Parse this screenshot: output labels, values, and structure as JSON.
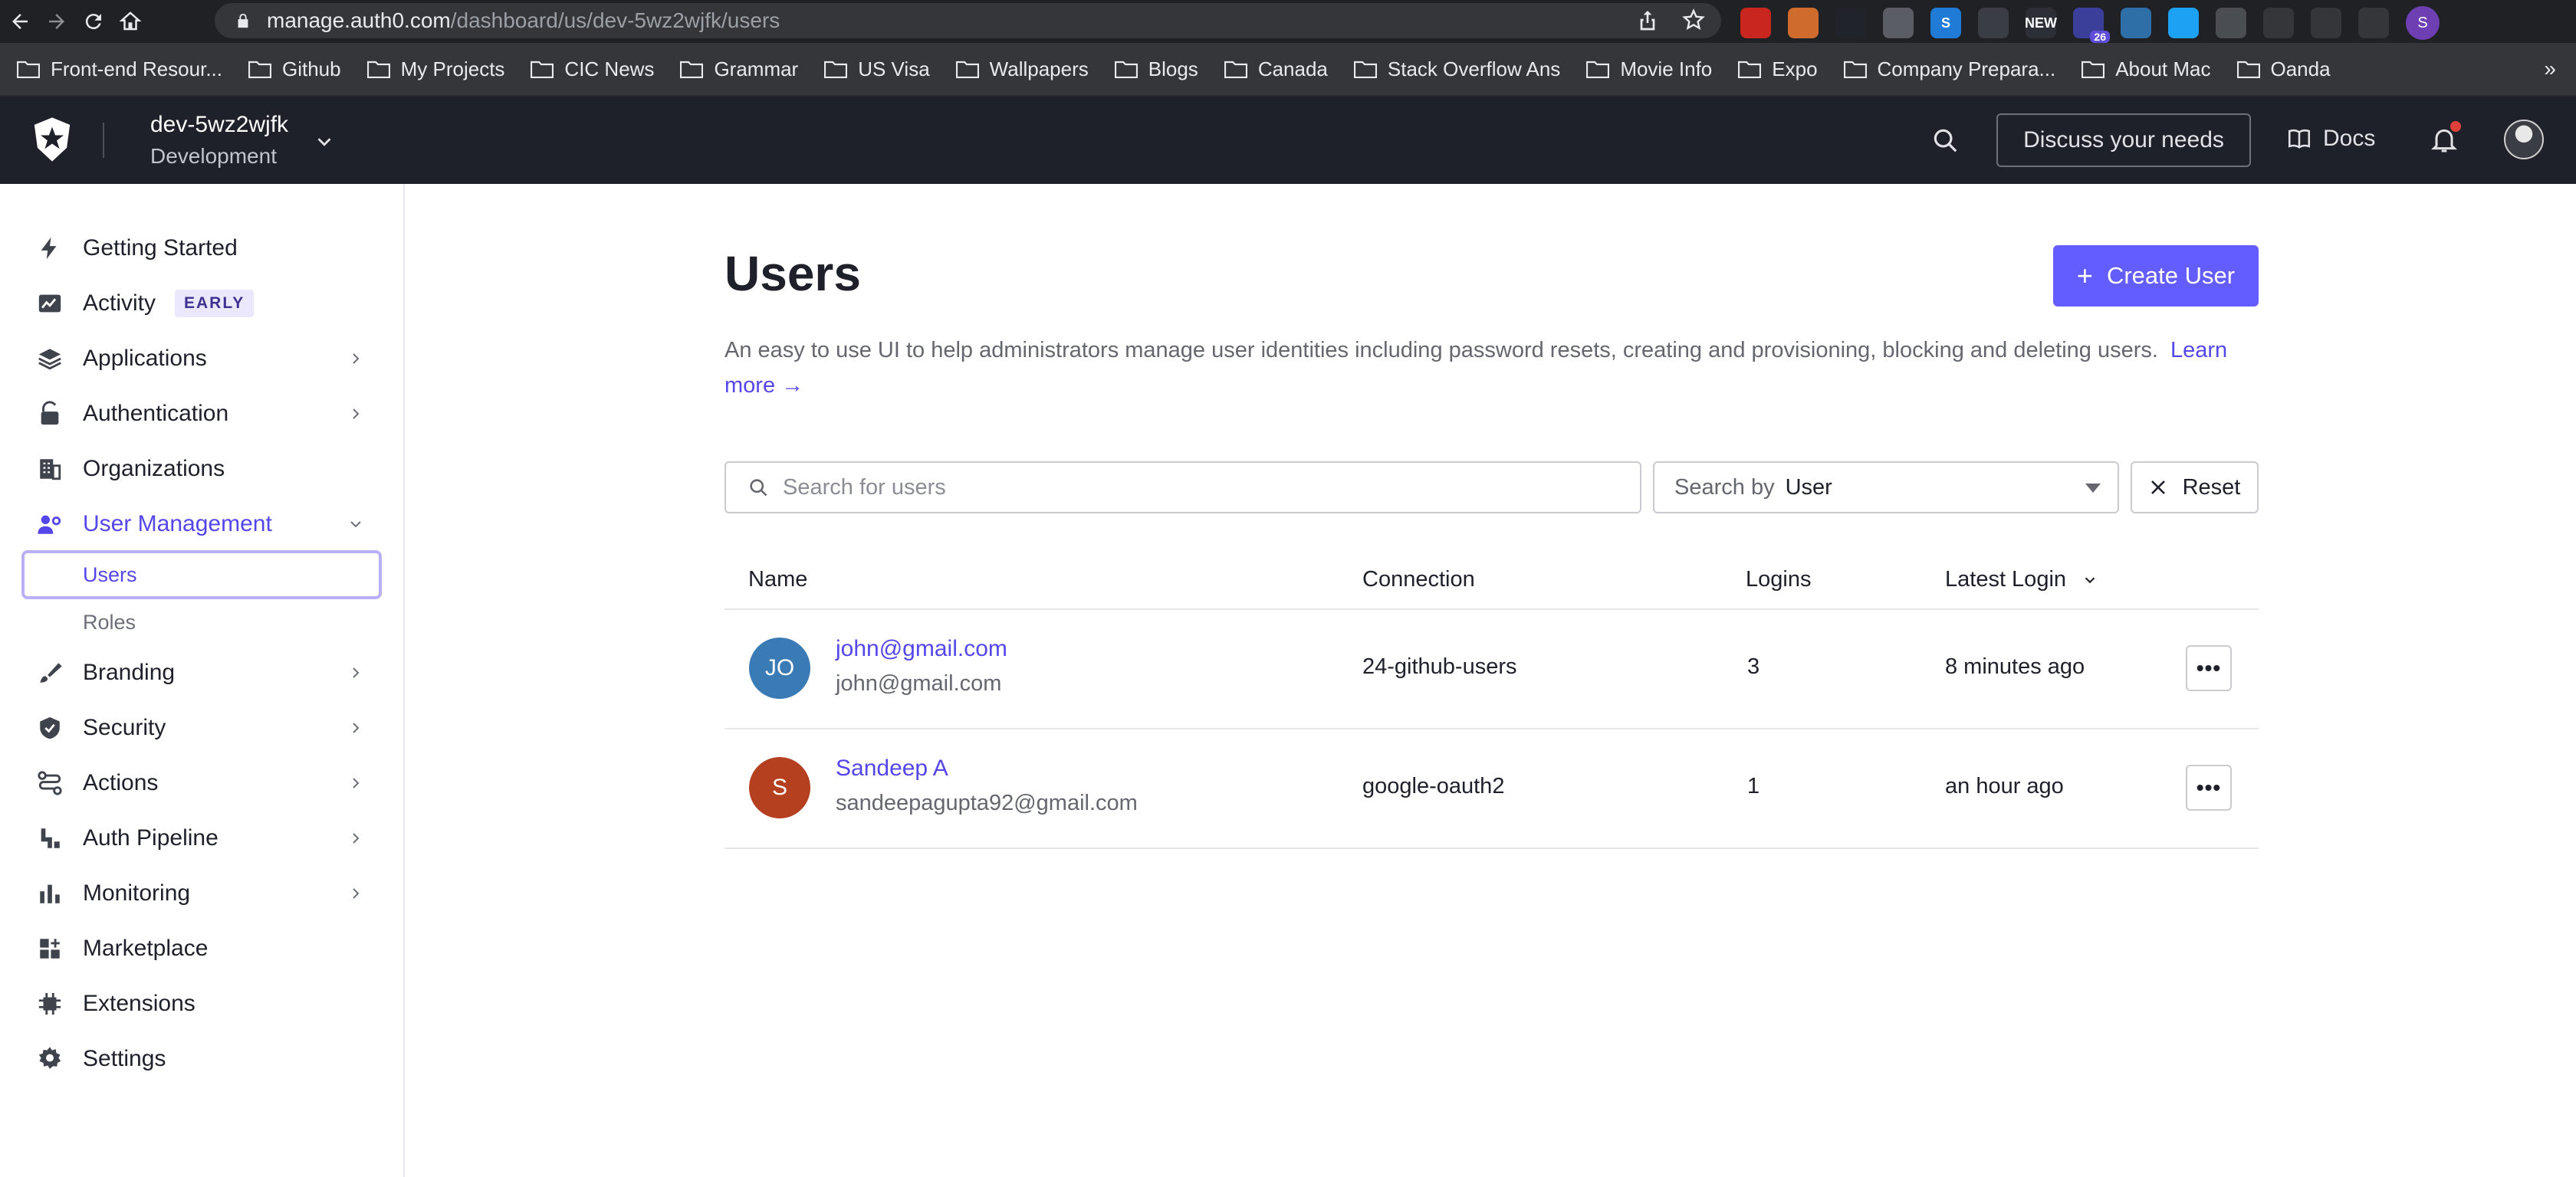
{
  "browser": {
    "url_host": "manage.auth0.com",
    "url_path": "/dashboard/us/dev-5wz2wjfk/users",
    "extensions": [
      {
        "icon": "ublock-icon",
        "color": "#c8261e",
        "text": ""
      },
      {
        "icon": "cookie-icon",
        "color": "#d06b2e",
        "text": ""
      },
      {
        "icon": "react-icon",
        "color": "#20232a",
        "text": ""
      },
      {
        "icon": "pen-icon",
        "color": "#5a5d63",
        "text": ""
      },
      {
        "icon": "s-logo-icon",
        "color": "#1f7bd6",
        "text": "S"
      },
      {
        "icon": "cloud-icon",
        "color": "#3a3d43",
        "text": ""
      },
      {
        "icon": "new-icon",
        "color": "#2c2f36",
        "text": "NEW"
      },
      {
        "icon": "counter-ext-icon",
        "color": "#3b3f9a",
        "text": "",
        "count": "26"
      },
      {
        "icon": "image-icon",
        "color": "#2f6fa8",
        "text": ""
      },
      {
        "icon": "feather-icon",
        "color": "#1da1f2",
        "text": ""
      },
      {
        "icon": "globe-icon",
        "color": "#4a4d52",
        "text": ""
      },
      {
        "icon": "puzzle-icon",
        "color": "#35363a",
        "text": ""
      },
      {
        "icon": "playlist-icon",
        "color": "#35363a",
        "text": ""
      },
      {
        "icon": "sidepanel-icon",
        "color": "#35363a",
        "text": ""
      }
    ],
    "profile_initial": "S"
  },
  "bookmarks": [
    "Front-end Resour...",
    "Github",
    "My Projects",
    "CIC News",
    "Grammar",
    "US Visa",
    "Wallpapers",
    "Blogs",
    "Canada",
    "Stack Overflow Ans",
    "Movie Info",
    "Expo",
    "Company Prepara...",
    "About Mac",
    "Oanda"
  ],
  "bookmarks_more": "»",
  "header": {
    "tenant_name": "dev-5wz2wjfk",
    "tenant_env": "Development",
    "discuss_label": "Discuss your needs",
    "docs_label": "Docs"
  },
  "sidebar": {
    "items": [
      {
        "label": "Getting Started",
        "icon": "bolt-icon"
      },
      {
        "label": "Activity",
        "icon": "activity-chart-icon",
        "badge": "EARLY"
      },
      {
        "label": "Applications",
        "icon": "layers-icon"
      },
      {
        "label": "Authentication",
        "icon": "lock-icon"
      },
      {
        "label": "Organizations",
        "icon": "building-icon"
      },
      {
        "label": "User Management",
        "icon": "users-icon"
      },
      {
        "label": "Branding",
        "icon": "brush-icon"
      },
      {
        "label": "Security",
        "icon": "shield-icon"
      },
      {
        "label": "Actions",
        "icon": "flow-icon"
      },
      {
        "label": "Auth Pipeline",
        "icon": "pipeline-icon"
      },
      {
        "label": "Monitoring",
        "icon": "bar-chart-icon"
      },
      {
        "label": "Marketplace",
        "icon": "grid-plus-icon"
      },
      {
        "label": "Extensions",
        "icon": "chip-icon"
      },
      {
        "label": "Settings",
        "icon": "gear-icon"
      }
    ],
    "sub_items": [
      {
        "label": "Users"
      },
      {
        "label": "Roles"
      }
    ]
  },
  "main": {
    "title": "Users",
    "create_label": "Create User",
    "description": "An easy to use UI to help administrators manage user identities including password resets, creating and provisioning, blocking and deleting users.",
    "learn_more": "Learn more →",
    "search_placeholder": "Search for users",
    "search_by_label": "Search by",
    "search_by_value": "User",
    "reset_label": "Reset",
    "columns": [
      "Name",
      "Connection",
      "Logins",
      "Latest Login"
    ],
    "rows": [
      {
        "initials": "JO",
        "avatar_color": "#3a7bb5",
        "name": "john@gmail.com",
        "email": "john@gmail.com",
        "connection": "24-github-users",
        "logins": "3",
        "latest_login": "8 minutes ago"
      },
      {
        "initials": "S",
        "avatar_color": "#b5401f",
        "name": "Sandeep A",
        "email": "sandeepagupta92@gmail.com",
        "connection": "google-oauth2",
        "logins": "1",
        "latest_login": "an hour ago"
      }
    ],
    "more_glyph": "•••"
  },
  "colors": {
    "accent": "#635dff",
    "active_nav": "#5546ea",
    "header_bg": "#1e212a"
  }
}
